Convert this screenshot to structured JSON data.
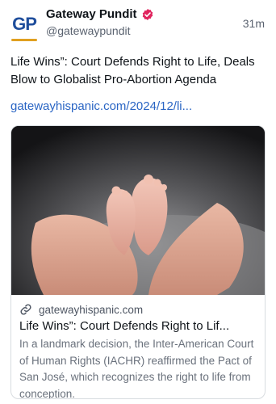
{
  "post": {
    "author": {
      "avatar_text": "GP",
      "name": "Gateway Pundit",
      "handle": "@gatewaypundit",
      "verified": true,
      "verified_color": "#e0245e"
    },
    "time": "31m",
    "text": "Life Wins”: Court Defends Right to Life, Deals Blow to Globalist Pro-Abortion Agenda",
    "link_text": "gatewayhispanic.com/2024/12/li...",
    "card": {
      "image_alt": "Baby feet held in adult hands",
      "link_icon": "link-icon",
      "domain": "gatewayhispanic.com",
      "title": "Life Wins”: Court Defends Right to Lif...",
      "description": "In a landmark decision, the Inter-American Court of Human Rights (IACHR) reaffirmed the Pact of San José, which recognizes the right to life from conception."
    }
  },
  "colors": {
    "link": "#2a65c4",
    "text": "#0f1419",
    "secondary": "#5b6370",
    "brand_blue": "#1f4e9c",
    "brand_gold": "#e0a020"
  }
}
